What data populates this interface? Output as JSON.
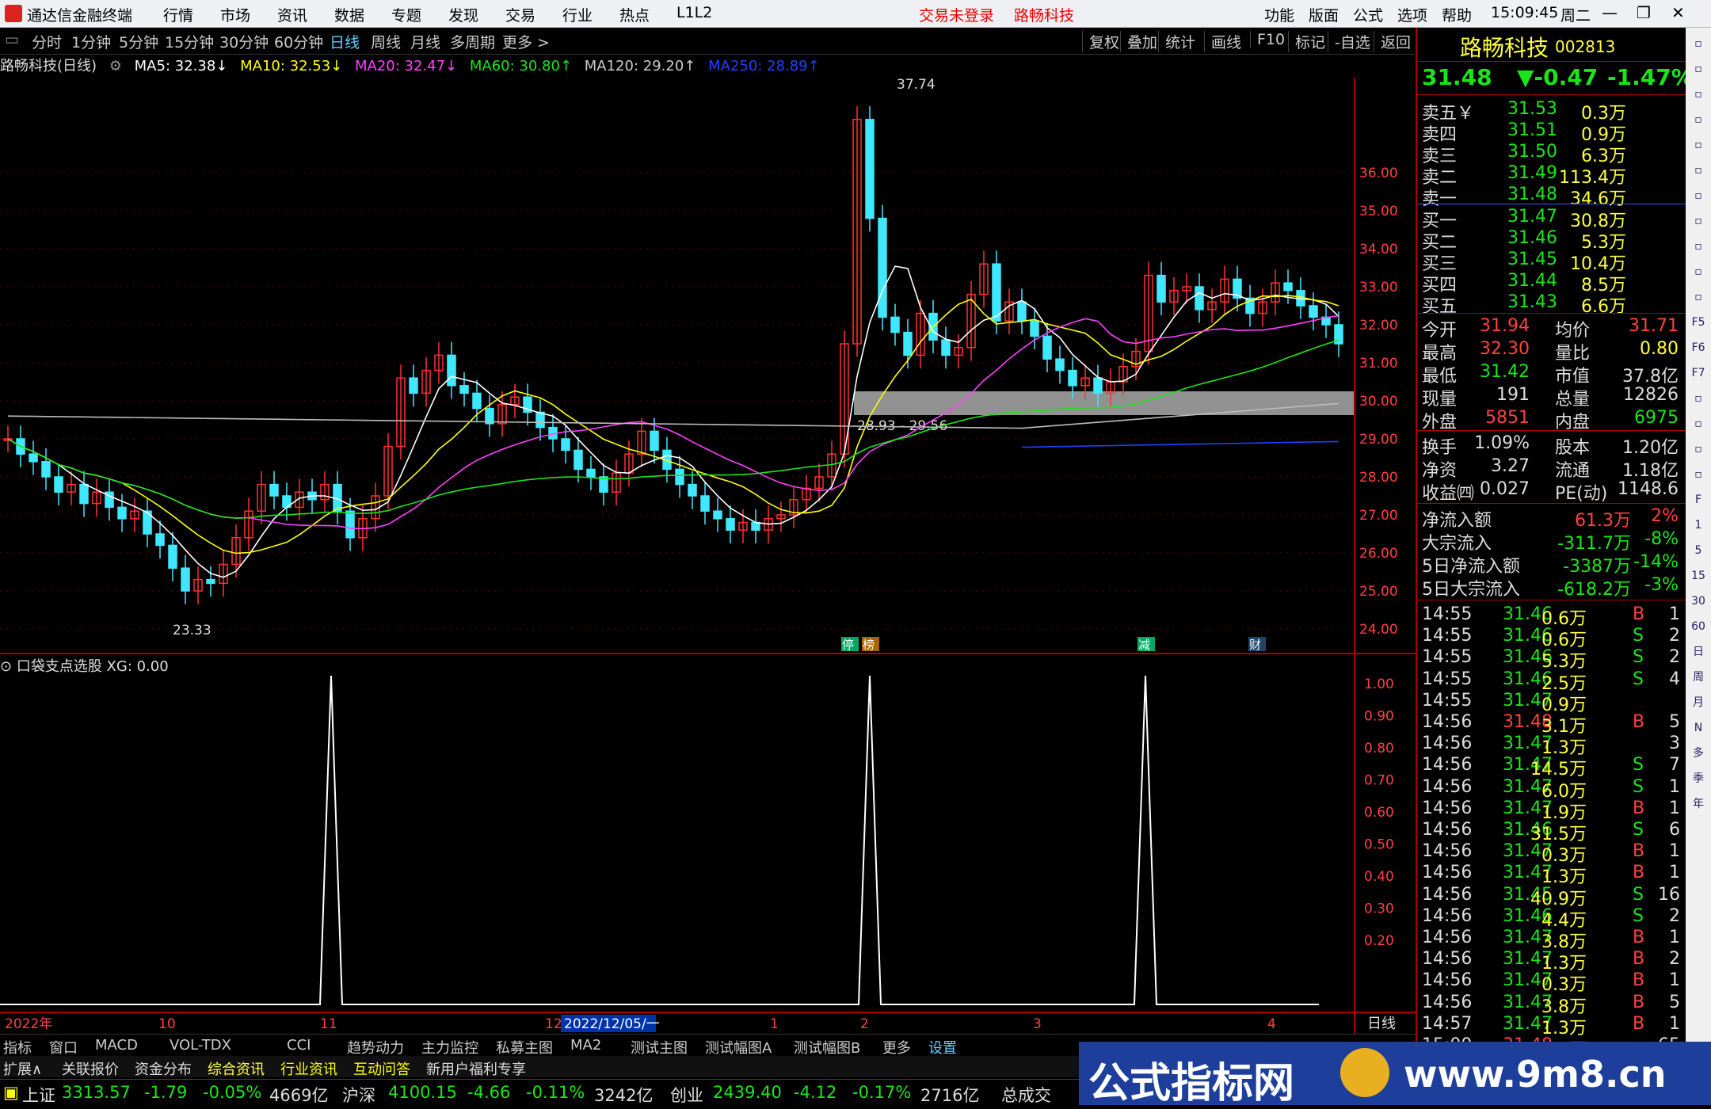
{
  "titlebar": {
    "app_name": "通达信金融终端",
    "menus": [
      "行情",
      "市场",
      "资讯",
      "数据",
      "专题",
      "发现",
      "交易",
      "行业",
      "热点",
      "L1L2"
    ],
    "login_status": "交易未登录",
    "stock_name": "路畅科技",
    "right_menus": [
      "功能",
      "版面",
      "公式",
      "选项",
      "帮助"
    ],
    "time": "15:09:45",
    "weekday": "周二"
  },
  "toolbar": {
    "periods": [
      "分时",
      "1分钟",
      "5分钟",
      "15分钟",
      "30分钟",
      "60分钟",
      "日线",
      "周线",
      "月线",
      "多周期",
      "更多 >"
    ],
    "active_period": "日线",
    "buttons": [
      "复权",
      "叠加",
      "统计",
      "画线",
      "F10",
      "标记",
      "-自选",
      "返回"
    ]
  },
  "ma_legend": {
    "title": "路畅科技(日线)",
    "items": [
      {
        "label": "MA5: 32.38↓",
        "color": "#ffffff"
      },
      {
        "label": "MA10: 32.53↓",
        "color": "#ffff00"
      },
      {
        "label": "MA20: 32.47↓",
        "color": "#ff40ff"
      },
      {
        "label": "MA60: 30.80↑",
        "color": "#19e619"
      },
      {
        "label": "MA120: 29.20↑",
        "color": "#cccccc"
      },
      {
        "label": "MA250: 28.89↑",
        "color": "#2040ff"
      }
    ]
  },
  "chart_data": {
    "type": "candlestick",
    "ylim": [
      23.5,
      38.5
    ],
    "y_ticks": [
      24.0,
      25.0,
      26.0,
      27.0,
      28.0,
      29.0,
      30.0,
      31.0,
      32.0,
      33.0,
      34.0,
      35.0,
      36.0
    ],
    "annotations": {
      "high_label": "37.74",
      "low_label": "23.33",
      "zone_label": "28.93 - 29.56"
    },
    "event_markers": [
      "停",
      "榜",
      "减",
      "财"
    ],
    "x_labels": [
      "2022年",
      "10",
      "11",
      "12",
      "2022/12/05/一",
      "1",
      "2",
      "3",
      "4"
    ],
    "period_label": "日线"
  },
  "indicator": {
    "title": "口袋支点选股  XG: 0.00",
    "y_ticks": [
      "1.00",
      "0.90",
      "0.80",
      "0.70",
      "0.60",
      "0.50",
      "0.40",
      "0.30",
      "0.20"
    ],
    "signals": [
      1,
      1,
      1
    ]
  },
  "quote": {
    "name": "路畅科技",
    "code": "002813",
    "price": "31.48",
    "change": "▼-0.47",
    "change_pct": "-1.47%",
    "asks": [
      {
        "label": "卖五￥",
        "price": "31.53",
        "vol": "0.3万"
      },
      {
        "label": "卖四",
        "price": "31.51",
        "vol": "0.9万"
      },
      {
        "label": "卖三",
        "price": "31.50",
        "vol": "6.3万"
      },
      {
        "label": "卖二",
        "price": "31.49",
        "vol": "113.4万"
      },
      {
        "label": "卖一",
        "price": "31.48",
        "vol": "34.6万"
      }
    ],
    "bids": [
      {
        "label": "买一",
        "price": "31.47",
        "vol": "30.8万"
      },
      {
        "label": "买二",
        "price": "31.46",
        "vol": "5.3万"
      },
      {
        "label": "买三",
        "price": "31.45",
        "vol": "10.4万"
      },
      {
        "label": "买四",
        "price": "31.44",
        "vol": "8.5万"
      },
      {
        "label": "买五",
        "price": "31.43",
        "vol": "6.6万"
      }
    ],
    "stats": [
      {
        "l1": "今开",
        "v1": "31.94",
        "c1": "up",
        "l2": "均价",
        "v2": "31.71",
        "c2": "up"
      },
      {
        "l1": "最高",
        "v1": "32.30",
        "c1": "up",
        "l2": "量比",
        "v2": "0.80",
        "c2": "ye"
      },
      {
        "l1": "最低",
        "v1": "31.42",
        "c1": "dn",
        "l2": "市值",
        "v2": "37.8亿",
        "c2": "wh"
      },
      {
        "l1": "现量",
        "v1": "191",
        "c1": "wh",
        "l2": "总量",
        "v2": "12826",
        "c2": "wh"
      },
      {
        "l1": "外盘",
        "v1": "5851",
        "c1": "up",
        "l2": "内盘",
        "v2": "6975",
        "c2": "dn"
      }
    ],
    "stats2": [
      {
        "l1": "换手",
        "v1": "1.09%",
        "l2": "股本",
        "v2": "1.20亿"
      },
      {
        "l1": "净资",
        "v1": "3.27",
        "l2": "流通",
        "v2": "1.18亿"
      },
      {
        "l1": "收益㈣",
        "v1": "0.027",
        "l2": "PE(动)",
        "v2": "1148.6"
      }
    ],
    "flows": [
      {
        "label": "净流入额",
        "value": "61.3万",
        "pct": "2%",
        "color": "up"
      },
      {
        "label": "大宗流入",
        "value": "-311.7万",
        "pct": "-8%",
        "color": "dn"
      },
      {
        "label": "5日净流入额",
        "value": "-3387万",
        "pct": "-14%",
        "color": "dn"
      },
      {
        "label": "5日大宗流入",
        "value": "-618.2万",
        "pct": "-3%",
        "color": "dn"
      }
    ],
    "ticks": [
      [
        "14:55",
        "31.46",
        "0.6万",
        "B",
        "1"
      ],
      [
        "14:55",
        "31.46",
        "0.6万",
        "S",
        "2"
      ],
      [
        "14:55",
        "31.46",
        "5.3万",
        "S",
        "2"
      ],
      [
        "14:55",
        "31.46",
        "2.5万",
        "S",
        "4"
      ],
      [
        "14:55",
        "31.47",
        "0.9万",
        "",
        ""
      ],
      [
        "14:56",
        "31.48",
        "3.1万",
        "B",
        "5"
      ],
      [
        "14:56",
        "31.47",
        "1.3万",
        "",
        "3"
      ],
      [
        "14:56",
        "31.47",
        "14.5万",
        "S",
        "7"
      ],
      [
        "14:56",
        "31.47",
        "6.0万",
        "S",
        "1"
      ],
      [
        "14:56",
        "31.47",
        "1.9万",
        "B",
        "1"
      ],
      [
        "14:56",
        "31.46",
        "31.5万",
        "S",
        "6"
      ],
      [
        "14:56",
        "31.47",
        "0.3万",
        "B",
        "1"
      ],
      [
        "14:56",
        "31.47",
        "1.3万",
        "B",
        "1"
      ],
      [
        "14:56",
        "31.45",
        "40.9万",
        "S",
        "16"
      ],
      [
        "14:56",
        "31.46",
        "4.4万",
        "S",
        "2"
      ],
      [
        "14:56",
        "31.47",
        "3.8万",
        "B",
        "1"
      ],
      [
        "14:56",
        "31.47",
        "1.3万",
        "B",
        "2"
      ],
      [
        "14:56",
        "31.47",
        "0.3万",
        "B",
        "1"
      ],
      [
        "14:56",
        "31.47",
        "3.8万",
        "B",
        "5"
      ],
      [
        "14:57",
        "31.47",
        "1.3万",
        "B",
        "1"
      ],
      [
        "15:00",
        "31.48",
        "60.1万",
        "",
        "65"
      ]
    ]
  },
  "side_icons": [
    "up-arrow",
    "refresh",
    "list",
    "chart",
    "bars",
    "line",
    "candle",
    "doc",
    "F10",
    "text",
    "page",
    "F5",
    "F6",
    "F7",
    "RSI",
    "move",
    "pen",
    "F5b",
    "F",
    "1",
    "5",
    "15",
    "30",
    "60",
    "日",
    "周",
    "月",
    "N",
    "多",
    "季",
    "年"
  ],
  "bottom_tabs": [
    "指标",
    "窗口",
    "MACD",
    "VOL-TDX",
    "CCI",
    "趋势动力",
    "主力监控",
    "私募主图",
    "MA2",
    "测试主图",
    "测试幅图A",
    "测试幅图B",
    "更多",
    "设置"
  ],
  "bottom_tabs2": [
    "扩展∧",
    "关联报价",
    "资金分布",
    "综合资讯",
    "行业资讯",
    "互动问答",
    "新用户福利专享"
  ],
  "status": {
    "sh": {
      "name": "上证",
      "val": "3313.57",
      "chg": "-1.79",
      "pct": "-0.05%",
      "amt": "4669亿"
    },
    "hs": {
      "name": "沪深",
      "val": "4100.15",
      "chg": "-4.66",
      "pct": "-0.11%",
      "amt": "3242亿"
    },
    "cy": {
      "name": "创业",
      "val": "2439.40",
      "chg": "-4.12",
      "pct": "-0.17%",
      "amt": "2716亿"
    },
    "extra": "总成交"
  },
  "watermark": {
    "text": "公式指标网",
    "url": "www.9m8.cn"
  }
}
